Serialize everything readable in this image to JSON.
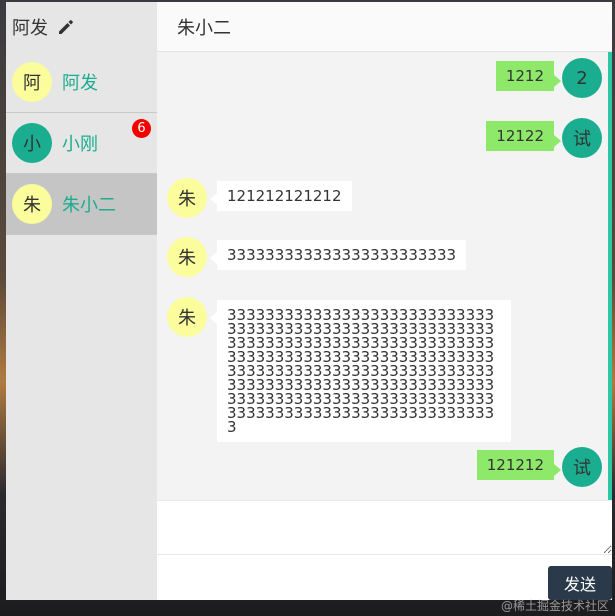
{
  "sidebar": {
    "user_name": "阿发",
    "contacts": [
      {
        "avatar": "阿",
        "name": "阿发",
        "avatar_color": "#fbfc9b"
      },
      {
        "avatar": "小",
        "name": "小刚",
        "avatar_color": "#1aad8f",
        "unread": "6"
      },
      {
        "avatar": "朱",
        "name": "朱小二",
        "avatar_color": "#fbfc9b",
        "active": true
      }
    ]
  },
  "chat": {
    "title": "朱小二",
    "messages": [
      {
        "dir": "out",
        "avatar": "2",
        "text": "1212"
      },
      {
        "dir": "out",
        "avatar": "试",
        "text": "12122"
      },
      {
        "dir": "in",
        "avatar": "朱",
        "text": "121212121212"
      },
      {
        "dir": "in",
        "avatar": "朱",
        "text": "333333333333333333333333"
      },
      {
        "dir": "in",
        "avatar": "朱",
        "text": "333333333333333333333333333333333333333333333333333333333333333333333333333333333333333333333333333333333333333333333333333333333333333333333333333333333333333333333333333333333333333333333333333333333333333333333333333333333"
      },
      {
        "dir": "out",
        "avatar": "试",
        "text": "121212"
      }
    ],
    "send_label": "发送"
  },
  "watermark": "@稀土掘金技术社区",
  "colors": {
    "accent": "#1aad8f",
    "bubble_out": "#8ee86a",
    "badge": "#f20000",
    "send_button": "#2b3a4a"
  }
}
